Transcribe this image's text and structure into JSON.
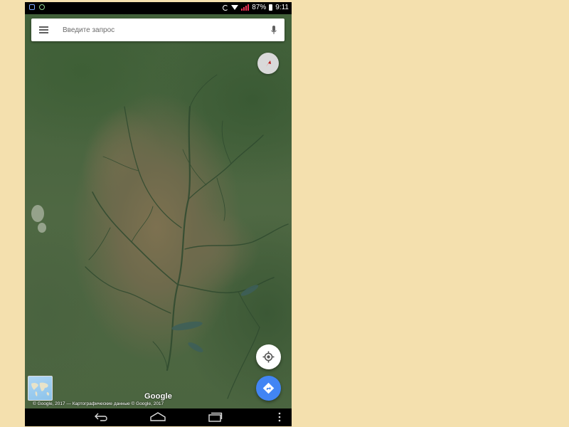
{
  "status_bar": {
    "battery_percent": "87%",
    "time": "9:11",
    "icons": [
      "notification-app-icon",
      "notification-google-icon",
      "sync-icon",
      "wifi-icon",
      "signal-icon",
      "battery-icon"
    ]
  },
  "search": {
    "placeholder": "Введите запрос",
    "value": "",
    "menu_icon": "menu-icon",
    "voice_icon": "mic-icon"
  },
  "map": {
    "type": "satellite",
    "logo": "Google",
    "copyright": "© Google, 2017 — Картографические данные © Google, 2017"
  },
  "controls": {
    "compass_icon": "compass-icon",
    "my_location_icon": "my-location-icon",
    "directions_icon": "directions-icon",
    "layers_icon": "layers-thumbnail"
  },
  "navigation": [
    "back-icon",
    "home-icon",
    "recents-icon",
    "overflow-menu-icon"
  ],
  "colors": {
    "accent": "#4285f4",
    "background": "#f4e0ae",
    "compass_needle": "#e53935"
  }
}
